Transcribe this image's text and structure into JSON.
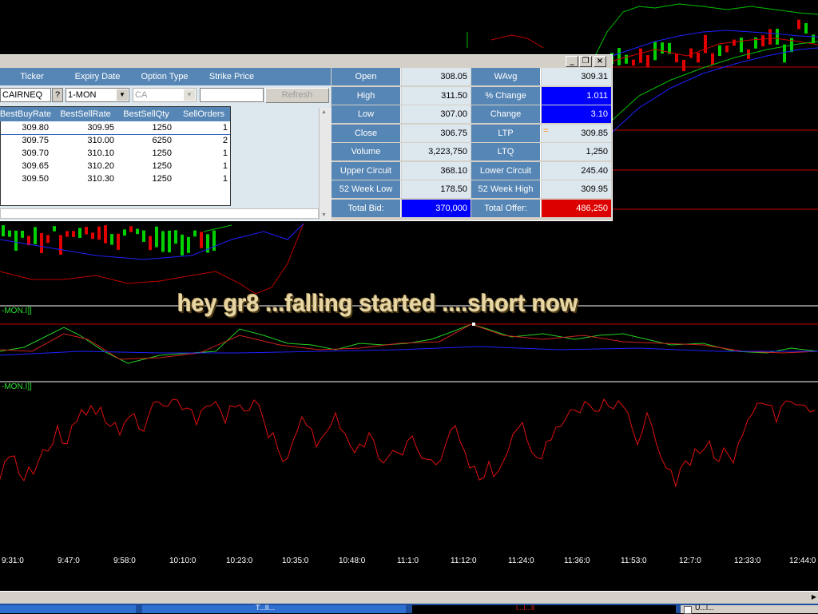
{
  "market_watch": {
    "window_buttons": {
      "minimize": "_",
      "restore": "❐",
      "close": "×"
    },
    "columns": {
      "ticker": "Ticker",
      "expiry": "Expiry Date",
      "option_type": "Option Type",
      "strike": "Strike Price"
    },
    "ticker_value": "CAIRNEQ",
    "help_label": "?",
    "expiry_value": "1-MON",
    "option_type_value": "CA",
    "strike_value": "",
    "refresh_label": "Refresh",
    "depth_headers": [
      "BestBuyRate",
      "BestSellRate",
      "BestSellQty",
      "SellOrders"
    ],
    "depth_rows": [
      [
        "309.80",
        "309.95",
        "1250",
        "1"
      ],
      [
        "309.75",
        "310.00",
        "6250",
        "2"
      ],
      [
        "309.70",
        "310.10",
        "1250",
        "1"
      ],
      [
        "309.65",
        "310.20",
        "1250",
        "1"
      ],
      [
        "309.50",
        "310.30",
        "1250",
        "1"
      ]
    ],
    "quote": [
      {
        "l1": "Open",
        "v1": "308.05",
        "l2": "WAvg",
        "v2": "309.31"
      },
      {
        "l1": "High",
        "v1": "311.50",
        "l2": "% Change",
        "v2": "1.011"
      },
      {
        "l1": "Low",
        "v1": "307.00",
        "l2": "Change",
        "v2": "3.10"
      },
      {
        "l1": "Close",
        "v1": "306.75",
        "l2": "LTP",
        "v2": "309.85"
      },
      {
        "l1": "Volume",
        "v1": "3,223,750",
        "l2": "LTQ",
        "v2": "1,250"
      },
      {
        "l1": "Upper Circuit",
        "v1": "368.10",
        "l2": "Lower Circuit",
        "v2": "245.40"
      },
      {
        "l1": "52 Week Low",
        "v1": "178.50",
        "l2": "52 Week High",
        "v2": "309.95"
      },
      {
        "l1": "Total Bid:",
        "v1": "370,000",
        "l2": "Total Offer:",
        "v2": "486,250"
      }
    ],
    "ltp_marker": "="
  },
  "chart": {
    "overlay_text": "hey gr8 ...falling started ....short now",
    "indicator1_label": "-MON.I]]",
    "indicator2_label": "-MON.I]]",
    "time_ticks": [
      "9:31:0",
      "9:47:0",
      "9:58:0",
      "10:10:0",
      "10:23:0",
      "10:35:0",
      "10:48:0",
      "11:1:0",
      "11:12:0",
      "11:24:0",
      "11:36:0",
      "11:53:0",
      "12:7:0",
      "12:33:0",
      "12:44:0"
    ]
  },
  "taskbar": {
    "item_2": "T...lI...",
    "item_3": "l...l...ll",
    "checkbox_label": "U...l..."
  },
  "colors": {
    "header_blue": "#5686b5",
    "bid_blue": "#0000ff",
    "offer_red": "#dd0000",
    "pane_bg": "#dde7ee"
  }
}
